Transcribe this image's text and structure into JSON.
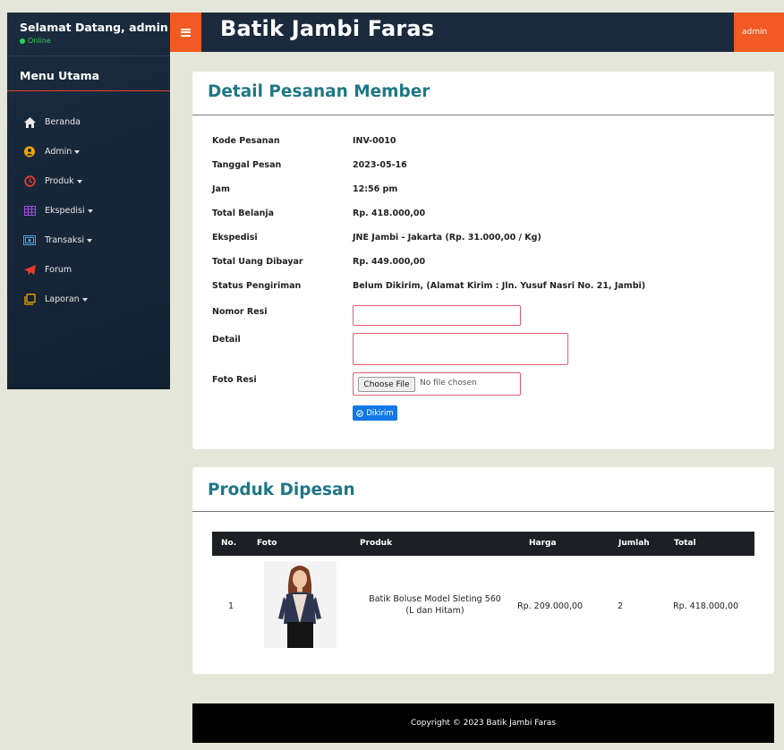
{
  "sidebar": {
    "greeting": "Selamat Datang, admin",
    "status": "Online",
    "menu_title": "Menu Utama",
    "items": [
      {
        "label": "Beranda",
        "icon": "home-icon",
        "dropdown": false
      },
      {
        "label": "Admin",
        "icon": "users-icon",
        "dropdown": true
      },
      {
        "label": "Produk",
        "icon": "clock-icon",
        "dropdown": true
      },
      {
        "label": "Ekspedisi",
        "icon": "grid-icon",
        "dropdown": true
      },
      {
        "label": "Transaksi",
        "icon": "cash-icon",
        "dropdown": true
      },
      {
        "label": "Forum",
        "icon": "send-icon",
        "dropdown": false
      },
      {
        "label": "Laporan",
        "icon": "copy-icon",
        "dropdown": true
      }
    ]
  },
  "topbar": {
    "brand": "Batik Jambi Faras",
    "user": "admin"
  },
  "detail": {
    "title": "Detail Pesanan Member",
    "rows": [
      {
        "label": "Kode Pesanan",
        "value": "INV-0010"
      },
      {
        "label": "Tanggal Pesan",
        "value": "2023-05-16"
      },
      {
        "label": "Jam",
        "value": "12:56 pm"
      },
      {
        "label": "Total Belanja",
        "value": "Rp. 418.000,00"
      },
      {
        "label": "Ekspedisi",
        "value": "JNE Jambi - Jakarta (Rp. 31.000,00 / Kg)"
      },
      {
        "label": "Total Uang Dibayar",
        "value": "Rp. 449.000,00"
      },
      {
        "label": "Status Pengiriman",
        "value": "Belum Dikirim, (Alamat Kirim : Jln. Yusuf Nasri No. 21, Jambi)"
      }
    ],
    "nomor_resi_label": "Nomor Resi",
    "nomor_resi_value": "",
    "detail_label": "Detail",
    "detail_value": "",
    "foto_resi_label": "Foto Resi",
    "file_button": "Choose File",
    "file_status": "No file chosen",
    "submit_label": "Dikirim"
  },
  "products": {
    "title": "Produk Dipesan",
    "columns": [
      "No.",
      "Foto",
      "Produk",
      "Harga",
      "Jumlah",
      "Total"
    ],
    "rows": [
      {
        "no": "1",
        "produk_line1": "Batik Boluse Model Sleting 560",
        "produk_line2": "(L dan Hitam)",
        "harga": "Rp. 209.000,00",
        "jumlah": "2",
        "total": "Rp. 418.000,00"
      }
    ]
  },
  "footer": {
    "text": "Copyright © 2023 Batik Jambi Faras"
  },
  "colors": {
    "accent": "#f15a22",
    "title": "#1e7885",
    "primary_button": "#1378e6",
    "online": "#2fd05a"
  }
}
